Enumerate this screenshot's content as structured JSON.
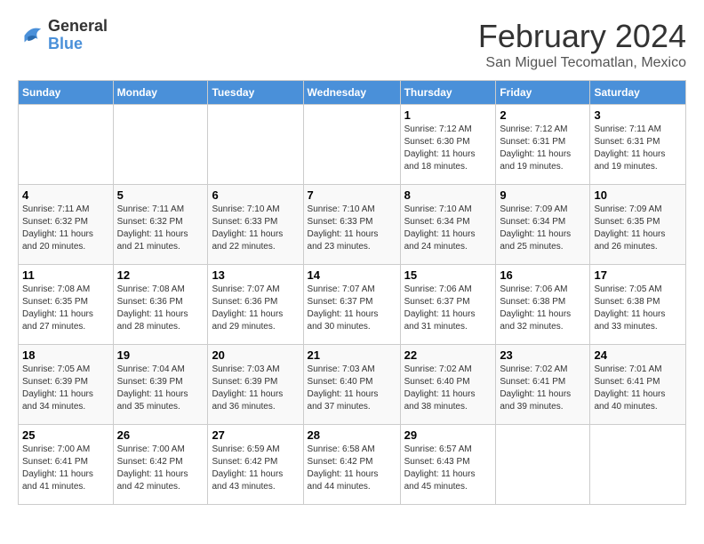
{
  "logo": {
    "general": "General",
    "blue": "Blue"
  },
  "header": {
    "title": "February 2024",
    "subtitle": "San Miguel Tecomatlan, Mexico"
  },
  "days_of_week": [
    "Sunday",
    "Monday",
    "Tuesday",
    "Wednesday",
    "Thursday",
    "Friday",
    "Saturday"
  ],
  "weeks": [
    [
      {
        "day": "",
        "info": ""
      },
      {
        "day": "",
        "info": ""
      },
      {
        "day": "",
        "info": ""
      },
      {
        "day": "",
        "info": ""
      },
      {
        "day": "1",
        "info": "Sunrise: 7:12 AM\nSunset: 6:30 PM\nDaylight: 11 hours\nand 18 minutes."
      },
      {
        "day": "2",
        "info": "Sunrise: 7:12 AM\nSunset: 6:31 PM\nDaylight: 11 hours\nand 19 minutes."
      },
      {
        "day": "3",
        "info": "Sunrise: 7:11 AM\nSunset: 6:31 PM\nDaylight: 11 hours\nand 19 minutes."
      }
    ],
    [
      {
        "day": "4",
        "info": "Sunrise: 7:11 AM\nSunset: 6:32 PM\nDaylight: 11 hours\nand 20 minutes."
      },
      {
        "day": "5",
        "info": "Sunrise: 7:11 AM\nSunset: 6:32 PM\nDaylight: 11 hours\nand 21 minutes."
      },
      {
        "day": "6",
        "info": "Sunrise: 7:10 AM\nSunset: 6:33 PM\nDaylight: 11 hours\nand 22 minutes."
      },
      {
        "day": "7",
        "info": "Sunrise: 7:10 AM\nSunset: 6:33 PM\nDaylight: 11 hours\nand 23 minutes."
      },
      {
        "day": "8",
        "info": "Sunrise: 7:10 AM\nSunset: 6:34 PM\nDaylight: 11 hours\nand 24 minutes."
      },
      {
        "day": "9",
        "info": "Sunrise: 7:09 AM\nSunset: 6:34 PM\nDaylight: 11 hours\nand 25 minutes."
      },
      {
        "day": "10",
        "info": "Sunrise: 7:09 AM\nSunset: 6:35 PM\nDaylight: 11 hours\nand 26 minutes."
      }
    ],
    [
      {
        "day": "11",
        "info": "Sunrise: 7:08 AM\nSunset: 6:35 PM\nDaylight: 11 hours\nand 27 minutes."
      },
      {
        "day": "12",
        "info": "Sunrise: 7:08 AM\nSunset: 6:36 PM\nDaylight: 11 hours\nand 28 minutes."
      },
      {
        "day": "13",
        "info": "Sunrise: 7:07 AM\nSunset: 6:36 PM\nDaylight: 11 hours\nand 29 minutes."
      },
      {
        "day": "14",
        "info": "Sunrise: 7:07 AM\nSunset: 6:37 PM\nDaylight: 11 hours\nand 30 minutes."
      },
      {
        "day": "15",
        "info": "Sunrise: 7:06 AM\nSunset: 6:37 PM\nDaylight: 11 hours\nand 31 minutes."
      },
      {
        "day": "16",
        "info": "Sunrise: 7:06 AM\nSunset: 6:38 PM\nDaylight: 11 hours\nand 32 minutes."
      },
      {
        "day": "17",
        "info": "Sunrise: 7:05 AM\nSunset: 6:38 PM\nDaylight: 11 hours\nand 33 minutes."
      }
    ],
    [
      {
        "day": "18",
        "info": "Sunrise: 7:05 AM\nSunset: 6:39 PM\nDaylight: 11 hours\nand 34 minutes."
      },
      {
        "day": "19",
        "info": "Sunrise: 7:04 AM\nSunset: 6:39 PM\nDaylight: 11 hours\nand 35 minutes."
      },
      {
        "day": "20",
        "info": "Sunrise: 7:03 AM\nSunset: 6:39 PM\nDaylight: 11 hours\nand 36 minutes."
      },
      {
        "day": "21",
        "info": "Sunrise: 7:03 AM\nSunset: 6:40 PM\nDaylight: 11 hours\nand 37 minutes."
      },
      {
        "day": "22",
        "info": "Sunrise: 7:02 AM\nSunset: 6:40 PM\nDaylight: 11 hours\nand 38 minutes."
      },
      {
        "day": "23",
        "info": "Sunrise: 7:02 AM\nSunset: 6:41 PM\nDaylight: 11 hours\nand 39 minutes."
      },
      {
        "day": "24",
        "info": "Sunrise: 7:01 AM\nSunset: 6:41 PM\nDaylight: 11 hours\nand 40 minutes."
      }
    ],
    [
      {
        "day": "25",
        "info": "Sunrise: 7:00 AM\nSunset: 6:41 PM\nDaylight: 11 hours\nand 41 minutes."
      },
      {
        "day": "26",
        "info": "Sunrise: 7:00 AM\nSunset: 6:42 PM\nDaylight: 11 hours\nand 42 minutes."
      },
      {
        "day": "27",
        "info": "Sunrise: 6:59 AM\nSunset: 6:42 PM\nDaylight: 11 hours\nand 43 minutes."
      },
      {
        "day": "28",
        "info": "Sunrise: 6:58 AM\nSunset: 6:42 PM\nDaylight: 11 hours\nand 44 minutes."
      },
      {
        "day": "29",
        "info": "Sunrise: 6:57 AM\nSunset: 6:43 PM\nDaylight: 11 hours\nand 45 minutes."
      },
      {
        "day": "",
        "info": ""
      },
      {
        "day": "",
        "info": ""
      }
    ]
  ]
}
